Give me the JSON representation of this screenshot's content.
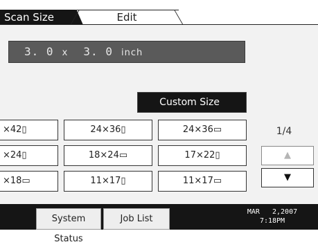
{
  "tabs": [
    {
      "label": "Scan Size",
      "active": true
    },
    {
      "label": "Edit",
      "active": false
    }
  ],
  "size_display": {
    "width_value": "3. 0",
    "times_symbol": "x",
    "height_value": "3. 0",
    "unit": "inch"
  },
  "custom_size_label": "Custom Size",
  "size_buttons": [
    {
      "label": "×42▯",
      "clipped_left": true
    },
    {
      "label": "24×36▯",
      "clipped_left": false
    },
    {
      "label": "24×36▭",
      "clipped_left": false
    },
    {
      "label": "×24▯",
      "clipped_left": true
    },
    {
      "label": "18×24▭",
      "clipped_left": false
    },
    {
      "label": "17×22▯",
      "clipped_left": false
    },
    {
      "label": "×18▭",
      "clipped_left": true
    },
    {
      "label": "11×17▯",
      "clipped_left": false
    },
    {
      "label": "11×17▭",
      "clipped_left": false
    }
  ],
  "pager": {
    "indicator": "1/4",
    "up_icon": "▲",
    "down_icon": "▼",
    "up_enabled": false,
    "down_enabled": true
  },
  "statusbar": {
    "system_status_label": "System Status",
    "job_list_label": "Job List",
    "date": "MAR   2,2007",
    "time": "7:18PM"
  },
  "colors": {
    "dark": "#151515",
    "display_bg": "#5a5a5a",
    "panel_bg": "#f2f2f2",
    "disabled_arrow": "#b5b5b5"
  }
}
